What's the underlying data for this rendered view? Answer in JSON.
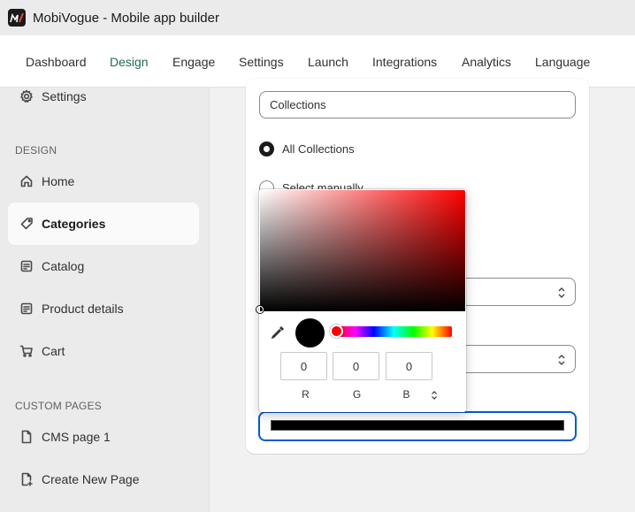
{
  "window": {
    "title": "MobiVogue - Mobile app builder"
  },
  "topnav": {
    "tabs": [
      {
        "label": "Dashboard",
        "active": false
      },
      {
        "label": "Design",
        "active": true
      },
      {
        "label": "Engage",
        "active": false
      },
      {
        "label": "Settings",
        "active": false
      },
      {
        "label": "Launch",
        "active": false
      },
      {
        "label": "Integrations",
        "active": false
      },
      {
        "label": "Analytics",
        "active": false
      },
      {
        "label": "Language",
        "active": false
      }
    ]
  },
  "sidebar": {
    "top_item": {
      "label": "Settings",
      "icon": "gear-icon"
    },
    "design_section": "DESIGN",
    "design_items": [
      {
        "label": "Home",
        "icon": "home-icon",
        "active": false
      },
      {
        "label": "Categories",
        "icon": "tag-icon",
        "active": true
      },
      {
        "label": "Catalog",
        "icon": "catalog-icon",
        "active": false
      },
      {
        "label": "Product details",
        "icon": "catalog-icon",
        "active": false
      },
      {
        "label": "Cart",
        "icon": "cart-icon",
        "active": false
      }
    ],
    "custom_section": "CUSTOM PAGES",
    "custom_items": [
      {
        "label": "CMS page 1",
        "icon": "page-icon"
      },
      {
        "label": "Create New Page",
        "icon": "new-page-icon"
      }
    ]
  },
  "main": {
    "title_field_value": "Collections",
    "radio_all": {
      "label": "All Collections",
      "selected": true
    },
    "radio_manual": {
      "label": "Select manually",
      "selected": false
    }
  },
  "color_picker": {
    "r": "0",
    "g": "0",
    "b": "0",
    "r_label": "R",
    "g_label": "G",
    "b_label": "B",
    "current_color": "#000000",
    "hue_color": "#ff0000"
  },
  "colors": {
    "accent_tab": "#1e6b57",
    "focus_ring": "#005bd3"
  }
}
